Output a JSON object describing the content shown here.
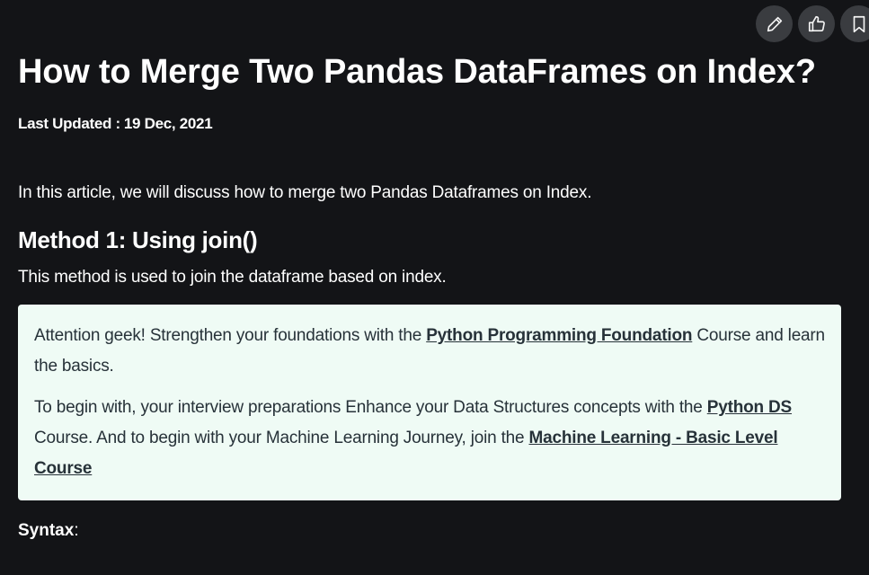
{
  "toolbar": {
    "icons": [
      "pencil-icon",
      "thumbs-up-icon",
      "bookmark-icon"
    ]
  },
  "article": {
    "title": "How to Merge Two Pandas DataFrames on Index?",
    "last_updated_label": "Last Updated :",
    "last_updated_value": "19 Dec, 2021",
    "intro": "In this article, we will discuss how to merge two Pandas Dataframes on Index.",
    "method1_heading": "Method 1: Using join()",
    "method1_desc": "This method is used to join the dataframe based on index.",
    "syntax_label": "Syntax",
    "syntax_colon": ":"
  },
  "callout": {
    "p1_pre": " Attention geek! Strengthen your foundations with the ",
    "p1_link": "Python Programming Foundation",
    "p1_post": " Course and learn the basics.",
    "p2_pre": "To begin with, your interview preparations Enhance your Data Structures concepts with the ",
    "p2_link1": "Python DS",
    "p2_mid": " Course. And to begin with your Machine Learning Journey, join the ",
    "p2_link2": "Machine Learning - Basic Level Course"
  },
  "colors": {
    "background": "#131417",
    "callout_bg": "#effbf5",
    "callout_text": "#273239",
    "button_bg": "#3a3c40"
  }
}
